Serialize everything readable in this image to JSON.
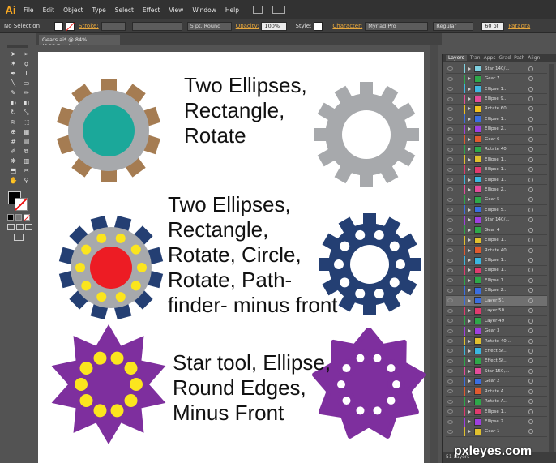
{
  "app": {
    "logo": "Ai"
  },
  "menu": [
    "File",
    "Edit",
    "Object",
    "Type",
    "Select",
    "Effect",
    "View",
    "Window",
    "Help"
  ],
  "control": {
    "selection": "No Selection",
    "stroke_label": "Stroke:",
    "stroke_weight": "",
    "brush": "5 pt. Round",
    "opacity_label": "Opacity:",
    "opacity": "100%",
    "style_label": "Style:",
    "character_label": "Character:",
    "font": "Myriad Pro",
    "weight": "Regular",
    "size": "60 pt",
    "paragraph": "Paragra"
  },
  "document": {
    "tab": "Gears.ai* @ 84% (RGB/Preview)"
  },
  "artboard": {
    "labels": [
      "Two Ellipses,\nRectangle,\nRotate",
      "Two Ellipses,\nRectangle,\nRotate, Circle,\nRotate, Path-\nfinder- minus front",
      "Star tool, Ellipse,\nRound Edges,\nMinus Front"
    ]
  },
  "colors": {
    "brown": "#a57c52",
    "teal": "#1ba89a",
    "grey": "#a7a9ac",
    "navy": "#243f73",
    "yellow": "#fbe51e",
    "red": "#ed1c24",
    "purple": "#7e2f9e"
  },
  "panel": {
    "tabs": [
      "Layers",
      "Tran",
      "Apps",
      "Grad",
      "Path",
      "Align"
    ],
    "footer": "51 Layers"
  },
  "layers": [
    {
      "name": "Star 140/...",
      "color": "#7fd1e0"
    },
    {
      "name": "Gear 7",
      "color": "#2ea84a"
    },
    {
      "name": "Ellipse 1...",
      "color": "#3fb6e0"
    },
    {
      "name": "Ellipse 9...",
      "color": "#e44c9a"
    },
    {
      "name": "Rotate 60",
      "color": "#f2c01e"
    },
    {
      "name": "Ellipse 1...",
      "color": "#3a6ee0"
    },
    {
      "name": "Ellipse 2...",
      "color": "#9e3fe0"
    },
    {
      "name": "Gear 6",
      "color": "#e05a2e"
    },
    {
      "name": "Rotate 40",
      "color": "#2ea84a"
    },
    {
      "name": "Ellipse 1...",
      "color": "#e0c02e"
    },
    {
      "name": "Ellipse 1...",
      "color": "#e03a6e"
    },
    {
      "name": "Ellipse 1...",
      "color": "#3ab6e0"
    },
    {
      "name": "Ellipse 2...",
      "color": "#e44c9a"
    },
    {
      "name": "Gear 5",
      "color": "#2ea84a"
    },
    {
      "name": "Ellipse 5...",
      "color": "#3a6ee0"
    },
    {
      "name": "Star 140/...",
      "color": "#9e3fe0"
    },
    {
      "name": "Gear 4",
      "color": "#2ea84a"
    },
    {
      "name": "Ellipse 1...",
      "color": "#e0c02e"
    },
    {
      "name": "Rotate 40",
      "color": "#e05a2e"
    },
    {
      "name": "Ellipse 1...",
      "color": "#3ab6e0"
    },
    {
      "name": "Ellipse 1...",
      "color": "#e03a6e"
    },
    {
      "name": "Ellipse 1...",
      "color": "#2ea84a"
    },
    {
      "name": "Ellipse 2...",
      "color": "#3a6ee0"
    },
    {
      "name": "Layer 51",
      "color": "#3a6ee0",
      "sel": true
    },
    {
      "name": "Layer 50",
      "color": "#e03a6e"
    },
    {
      "name": "Layer 49",
      "color": "#2ea84a"
    },
    {
      "name": "Gear 3",
      "color": "#9e3fe0"
    },
    {
      "name": "Rotate 40...",
      "color": "#e0c02e"
    },
    {
      "name": "Effect,St...",
      "color": "#3ab6e0"
    },
    {
      "name": "Effect,St...",
      "color": "#2ea84a"
    },
    {
      "name": "Star 150,...",
      "color": "#e44c9a"
    },
    {
      "name": "Gear 2",
      "color": "#3a6ee0"
    },
    {
      "name": "Rotate A...",
      "color": "#e05a2e"
    },
    {
      "name": "Rotate A...",
      "color": "#2ea84a"
    },
    {
      "name": "Ellipse 1...",
      "color": "#e03a6e"
    },
    {
      "name": "Ellipse 2...",
      "color": "#9e3fe0"
    },
    {
      "name": "Gear 1",
      "color": "#e0c02e"
    }
  ],
  "watermark": "pxleyes.com"
}
